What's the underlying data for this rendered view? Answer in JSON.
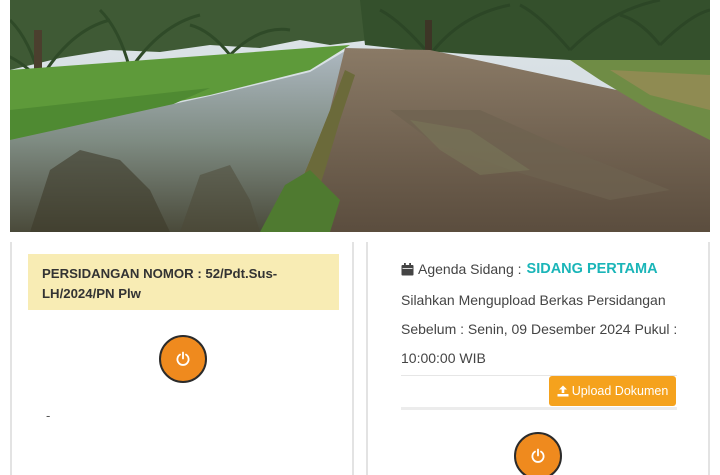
{
  "hero": {
    "image": "canal-and-palm-plantation-photo"
  },
  "left_card": {
    "case_title": "PERSIDANGAN NOMOR : 52/Pdt.Sus-LH/2024/PN Plw",
    "power_icon": "power-icon",
    "note": "-"
  },
  "right_card": {
    "agenda_label": "Agenda Sidang :",
    "agenda_value": "SIDANG PERTAMA",
    "info_line1": "Silahkan Mengupload Berkas Persidangan",
    "info_line2": "Sebelum : Senin, 09 Desember 2024 Pukul :",
    "info_line3": "10:00:00 WIB",
    "upload_label": "Upload Dokumen",
    "calendar_icon": "calendar-icon",
    "upload_icon": "upload-icon",
    "power_icon": "power-icon"
  },
  "colors": {
    "case_box_bg": "#f8ecb4",
    "agenda_accent": "#1ab5b8",
    "upload_button": "#f5a21d",
    "power_button": "#ef8a1e"
  }
}
